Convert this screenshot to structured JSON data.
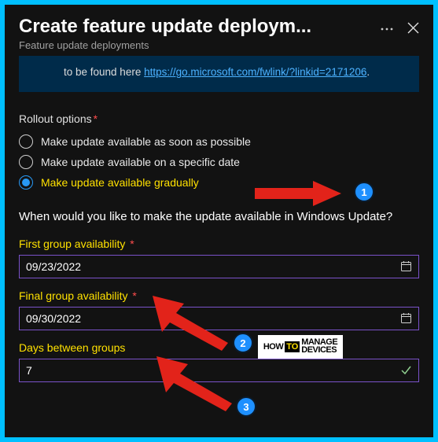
{
  "header": {
    "title": "Create feature update deploym...",
    "subtitle": "Feature update deployments"
  },
  "banner": {
    "text_prefix": "to be found here ",
    "link_text": "https://go.microsoft.com/fwlink/?linkid=2171206",
    "text_suffix": "."
  },
  "rollout": {
    "label": "Rollout options",
    "options": [
      {
        "label": "Make update available as soon as possible",
        "selected": false
      },
      {
        "label": "Make update available on a specific date",
        "selected": false
      },
      {
        "label": "Make update available gradually",
        "selected": true
      }
    ]
  },
  "question": "When would you like to make the update available in Windows Update?",
  "fields": {
    "first_group": {
      "label": "First group availability",
      "value": "09/23/2022"
    },
    "final_group": {
      "label": "Final group availability",
      "value": "09/30/2022"
    },
    "days_between": {
      "label": "Days between groups",
      "value": "7"
    }
  },
  "annotations": {
    "badge1": "1",
    "badge2": "2",
    "badge3": "3",
    "logo": {
      "how": "HOW",
      "to": "TO",
      "rest1": "MANAGE",
      "rest2": "DEVICES"
    }
  }
}
